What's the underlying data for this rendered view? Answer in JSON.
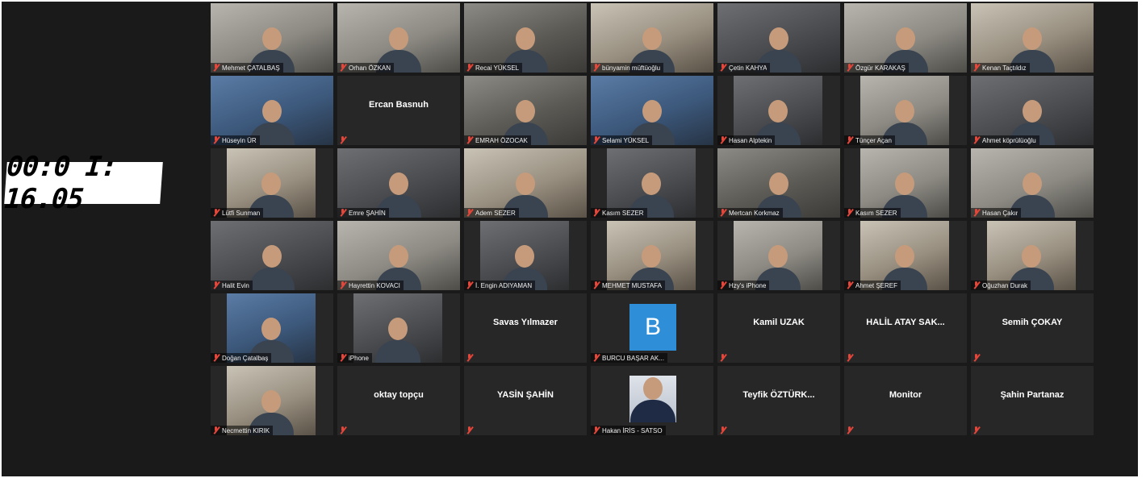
{
  "timer": {
    "value": "00:0 I: 16.05"
  },
  "tiles": [
    {
      "name": "Mehmet ÇATALBAŞ",
      "type": "video",
      "tone": "c1"
    },
    {
      "name": "Orhan ÖZKAN",
      "type": "video",
      "tone": "c1"
    },
    {
      "name": "Recai YÜKSEL",
      "type": "video",
      "tone": ""
    },
    {
      "name": "bünyamin müftüoğlu",
      "type": "video",
      "tone": "c3"
    },
    {
      "name": "Çetin KAHYA",
      "type": "video",
      "tone": "c2"
    },
    {
      "name": "Özgür KARAKAŞ",
      "type": "video",
      "tone": "c1"
    },
    {
      "name": "Kenan Taçtıldız",
      "type": "video",
      "tone": "c3",
      "active": true
    },
    {
      "name": "Hüseyin ÜR",
      "type": "video",
      "tone": "c4"
    },
    {
      "name": "Ercan Basnuh",
      "type": "name"
    },
    {
      "name": "EMRAH ÖZOCAK",
      "type": "video",
      "tone": ""
    },
    {
      "name": "Selami YÜKSEL",
      "type": "video",
      "tone": "c4"
    },
    {
      "name": "Hasan Alptekin",
      "type": "video",
      "tone": "c2",
      "narrow": true
    },
    {
      "name": "Tünçer Açan",
      "type": "video",
      "tone": "c1",
      "narrow": true
    },
    {
      "name": "Ahmet köprülüoğlu",
      "type": "video",
      "tone": "c2"
    },
    {
      "name": "Lütfi Sunman",
      "type": "video",
      "tone": "c3",
      "narrow": true
    },
    {
      "name": "Emre ŞAHİN",
      "type": "video",
      "tone": "c2"
    },
    {
      "name": "Adem SEZER",
      "type": "video",
      "tone": "c3"
    },
    {
      "name": "Kasım SEZER",
      "type": "video",
      "tone": "c2",
      "narrow": true
    },
    {
      "name": "Mertcan Korkmaz",
      "type": "video",
      "tone": ""
    },
    {
      "name": "Kasım SEZER",
      "type": "video",
      "tone": "c1",
      "narrow": true
    },
    {
      "name": "Hasan Çakır",
      "type": "video",
      "tone": "c1"
    },
    {
      "name": "Halit Evin",
      "type": "video",
      "tone": "c2"
    },
    {
      "name": "Hayrettin KOVACI",
      "type": "video",
      "tone": "c1"
    },
    {
      "name": "İ. Engin ADIYAMAN",
      "type": "video",
      "tone": "c2",
      "narrow": true
    },
    {
      "name": "MEHMET MUSTAFA",
      "type": "video",
      "tone": "c3",
      "narrow": true
    },
    {
      "name": "Hzy's iPhone",
      "type": "video",
      "tone": "c1",
      "narrow": true
    },
    {
      "name": "Ahmet ŞEREF",
      "type": "video",
      "tone": "c3",
      "narrow": true
    },
    {
      "name": "Oğuzhan Durak",
      "type": "video",
      "tone": "c3",
      "narrow": true
    },
    {
      "name": "Doğan Çatalbaş",
      "type": "video",
      "tone": "c4",
      "narrow": true
    },
    {
      "name": "iPhone",
      "type": "video",
      "tone": "c2",
      "narrow": true
    },
    {
      "name": "Savas Yılmazer",
      "type": "name"
    },
    {
      "name": "BURCU BAŞAR AK...",
      "type": "avatar",
      "letter": "B"
    },
    {
      "name": "Kamil UZAK",
      "type": "name"
    },
    {
      "name": "HALİL ATAY SAK...",
      "type": "name"
    },
    {
      "name": "Semih ÇOKAY",
      "type": "name"
    },
    {
      "name": "Necmettin KIRIK",
      "type": "video",
      "tone": "c3",
      "narrow": true
    },
    {
      "name": "oktay topçu",
      "type": "name"
    },
    {
      "name": "YASİN ŞAHİN",
      "type": "name"
    },
    {
      "name": "Hakan İRİS - SATSO",
      "type": "photo"
    },
    {
      "name": "Teyfik ÖZTÜRK...",
      "type": "name"
    },
    {
      "name": "Monitor",
      "type": "name"
    },
    {
      "name": "Şahin Partanaz",
      "type": "name"
    }
  ]
}
